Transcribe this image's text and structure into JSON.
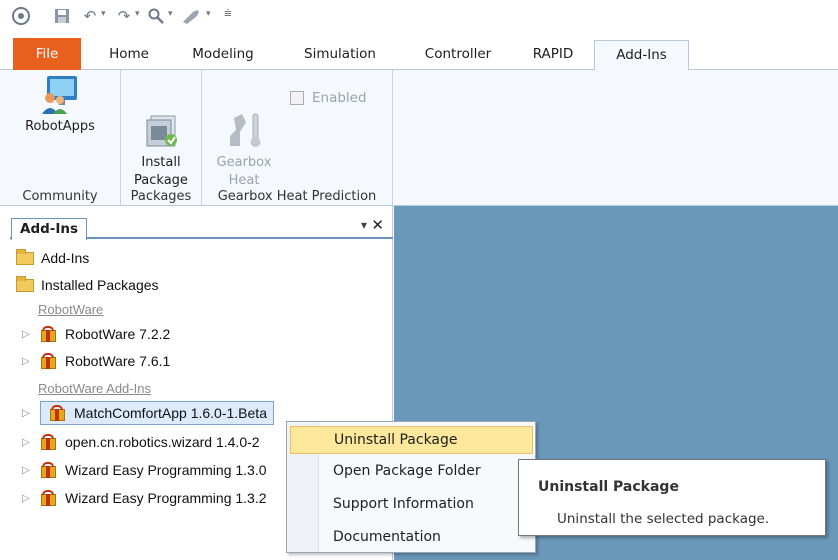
{
  "quick_access": {
    "icons": [
      "app-icon",
      "save-icon",
      "undo-icon",
      "redo-icon",
      "zoom-icon",
      "tool-icon",
      "customize-icon"
    ]
  },
  "tabs": [
    {
      "label": "File"
    },
    {
      "label": "Home"
    },
    {
      "label": "Modeling"
    },
    {
      "label": "Simulation"
    },
    {
      "label": "Controller"
    },
    {
      "label": "RAPID"
    },
    {
      "label": "Add-Ins",
      "active": true
    }
  ],
  "ribbon": {
    "groups": [
      {
        "label": "Community",
        "buttons": [
          {
            "label": "RobotApps",
            "icon": "robotapps-icon"
          }
        ]
      },
      {
        "label": "Packages",
        "buttons": [
          {
            "label": "Install\nPackage",
            "icon": "install-package-icon"
          }
        ]
      },
      {
        "label": "Gearbox Heat Prediction",
        "buttons": [
          {
            "label": "Gearbox\nHeat",
            "icon": "gearbox-heat-icon",
            "disabled": true
          }
        ],
        "checkbox": {
          "label": "Enabled",
          "checked": false,
          "disabled": true
        }
      }
    ]
  },
  "panel": {
    "title": "Add-Ins",
    "pin_glyph": "▾",
    "close_glyph": "✕",
    "tree": [
      {
        "type": "folder",
        "label": "Add-Ins"
      },
      {
        "type": "folder",
        "label": "Installed Packages"
      },
      {
        "type": "category",
        "label": "RobotWare"
      },
      {
        "type": "package",
        "label": "RobotWare 7.2.2"
      },
      {
        "type": "package",
        "label": "RobotWare 7.6.1"
      },
      {
        "type": "category",
        "label": "RobotWare Add-Ins"
      },
      {
        "type": "package",
        "label": "MatchComfortApp 1.6.0-1.Beta",
        "selected": true
      },
      {
        "type": "package",
        "label": "open.cn.robotics.wizard 1.4.0-2"
      },
      {
        "type": "package",
        "label": "Wizard Easy Programming 1.3.0"
      },
      {
        "type": "package",
        "label": "Wizard Easy Programming 1.3.2"
      }
    ]
  },
  "context_menu": {
    "items": [
      {
        "label": "Uninstall Package",
        "highlighted": true
      },
      {
        "label": "Open Package Folder"
      },
      {
        "label": "Support Information"
      },
      {
        "label": "Documentation"
      }
    ]
  },
  "tooltip": {
    "title": "Uninstall Package",
    "body": "Uninstall the selected package."
  },
  "colors": {
    "file_tab": "#e95f1e",
    "ribbon_bg": "#f5f8fc",
    "content_bg": "#6a98ba",
    "menu_highlight": "#fde89b"
  }
}
